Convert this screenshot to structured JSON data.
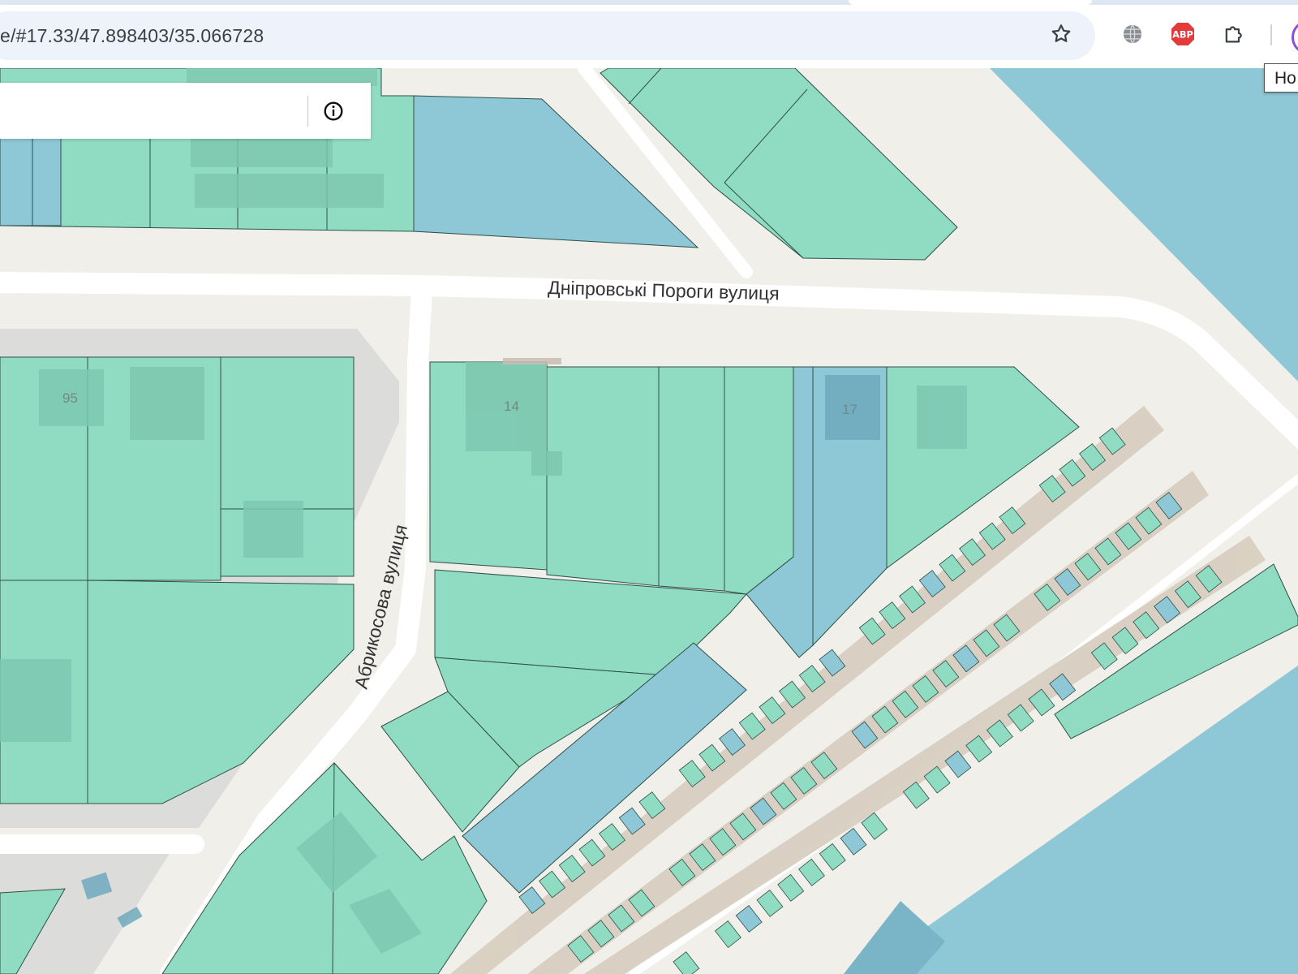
{
  "browser": {
    "url": "e/#17.33/47.898403/35.066728",
    "tooltip": "Но",
    "icons": [
      "bookmark-star-icon",
      "globe-icon",
      "adblock-plus-icon",
      "extensions-puzzle-icon",
      "profile-avatar-icon"
    ]
  },
  "map": {
    "zoom": 17.33,
    "center": {
      "lat": 47.898403,
      "lon": 35.066728
    },
    "streets": [
      "Дніпровські Пороги вулиця",
      "Абрикосова вулиця"
    ],
    "house_numbers": [
      "95",
      "14",
      "17"
    ],
    "search_panel": {
      "value": "",
      "info_icon": "info-icon"
    }
  },
  "colors": {
    "land_background": "#f0efea",
    "road_white": "#ffffff",
    "block_gray": "#dcdcda",
    "parcel_green": "#8fdcc3",
    "parcel_blue": "#8ec7d6",
    "water": "#8ec7d6",
    "building": "#7ec8b0",
    "garage_row": "#d7cdbf"
  }
}
